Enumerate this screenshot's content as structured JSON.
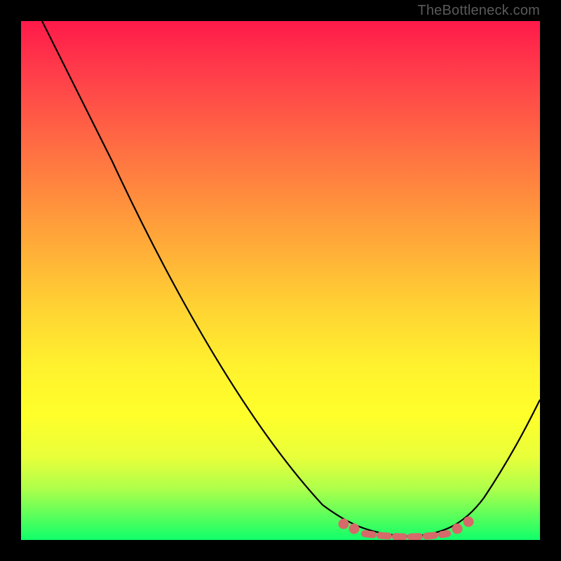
{
  "watermark": "TheBottleneck.com",
  "chart_data": {
    "type": "line",
    "title": "",
    "xlabel": "",
    "ylabel": "",
    "xlim": [
      0,
      100
    ],
    "ylim": [
      0,
      100
    ],
    "grid": false,
    "series": [
      {
        "name": "bottleneck-curve",
        "x": [
          4,
          10,
          18,
          27,
          40,
          50,
          58,
          63,
          67,
          72,
          75,
          80,
          84,
          87,
          90,
          95,
          100
        ],
        "values": [
          100,
          92,
          80,
          66,
          45,
          30,
          18,
          10,
          4,
          1,
          0,
          1,
          4,
          10,
          18,
          27,
          32
        ]
      }
    ],
    "markers": {
      "name": "optimal-range",
      "x": [
        62,
        64,
        84,
        86
      ],
      "values": [
        3,
        2,
        2,
        3
      ]
    },
    "flat_region": {
      "x_start": 66,
      "x_end": 82,
      "value": 0.5
    },
    "background_gradient_stops": [
      {
        "pct": 0,
        "color": "#ff1a4a"
      },
      {
        "pct": 22,
        "color": "#ff6644"
      },
      {
        "pct": 44,
        "color": "#ffae38"
      },
      {
        "pct": 66,
        "color": "#fff02e"
      },
      {
        "pct": 84,
        "color": "#e8ff3a"
      },
      {
        "pct": 100,
        "color": "#10ff6a"
      }
    ]
  },
  "colors": {
    "curve": "#000000",
    "marker": "#d66a6a",
    "watermark": "#5a5a5a",
    "frame": "#000000"
  }
}
